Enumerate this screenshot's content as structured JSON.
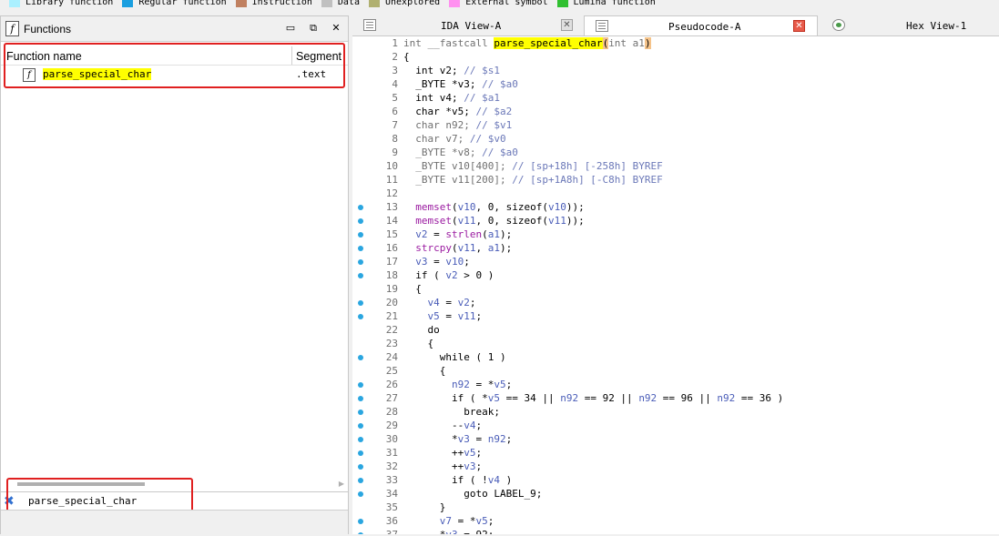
{
  "legend": [
    {
      "label": "Library function",
      "color": "#aaf0ff"
    },
    {
      "label": "Regular function",
      "color": "#1a9fe0"
    },
    {
      "label": "Instruction",
      "color": "#c08060"
    },
    {
      "label": "Data",
      "color": "#c0c0c0"
    },
    {
      "label": "Unexplored",
      "color": "#b0b070"
    },
    {
      "label": "External symbol",
      "color": "#ff90f0"
    },
    {
      "label": "Lumina function",
      "color": "#30c030"
    }
  ],
  "functions_panel": {
    "title": "Functions",
    "logo": "f",
    "columns": {
      "name": "Function name",
      "segment": "Segment"
    },
    "rows": [
      {
        "icon": "f",
        "name": "parse_special_char",
        "segment": ".text"
      }
    ],
    "filter_value": "parse_special_char",
    "btn_minimize": "▭",
    "btn_float": "⧉",
    "btn_close": "✕",
    "filter_clear": "✖",
    "scroll_right": "▶"
  },
  "tabs": [
    {
      "label": "IDA View-A",
      "close": "✕"
    },
    {
      "label": "Pseudocode-A",
      "close": "✕"
    },
    {
      "label": "Hex View-1"
    }
  ],
  "code": {
    "lines": [
      {
        "n": "1",
        "dot": false,
        "html": "<span class='c-gr'>int __fastcall </span><span class='c-hl'>parse_special_char</span><span class='c-hlp'>(</span><span class='c-gr'>int a1</span><span class='c-hlp'>)</span>"
      },
      {
        "n": "2",
        "dot": false,
        "html": "{"
      },
      {
        "n": "3",
        "dot": false,
        "html": "  int v2; <span class='c-cm'>// $s1</span>"
      },
      {
        "n": "4",
        "dot": false,
        "html": "  _BYTE *v3; <span class='c-cm'>// $a0</span>"
      },
      {
        "n": "5",
        "dot": false,
        "html": "  int v4; <span class='c-cm'>// $a1</span>"
      },
      {
        "n": "6",
        "dot": false,
        "html": "  char *v5; <span class='c-cm'>// $a2</span>"
      },
      {
        "n": "7",
        "dot": false,
        "html": "  <span class='c-gr'>char n92;</span> <span class='c-cm'>// $v1</span>"
      },
      {
        "n": "8",
        "dot": false,
        "html": "  <span class='c-gr'>char v7;</span> <span class='c-cm'>// $v0</span>"
      },
      {
        "n": "9",
        "dot": false,
        "html": "  <span class='c-gr'>_BYTE *v8;</span> <span class='c-cm'>// $a0</span>"
      },
      {
        "n": "10",
        "dot": false,
        "html": "  <span class='c-gr'>_BYTE v10[400];</span> <span class='c-cm'>// [sp+18h] [-258h] BYREF</span>"
      },
      {
        "n": "11",
        "dot": false,
        "html": "  <span class='c-gr'>_BYTE v11[200];</span> <span class='c-cm'>// [sp+1A8h] [-C8h] BYREF</span>"
      },
      {
        "n": "12",
        "dot": false,
        "html": ""
      },
      {
        "n": "13",
        "dot": true,
        "html": "  <span class='c-fn'>memset</span>(<span class='c-var'>v10</span>, 0, sizeof(<span class='c-var'>v10</span>));"
      },
      {
        "n": "14",
        "dot": true,
        "html": "  <span class='c-fn'>memset</span>(<span class='c-var'>v11</span>, 0, sizeof(<span class='c-var'>v11</span>));"
      },
      {
        "n": "15",
        "dot": true,
        "html": "  <span class='c-var'>v2</span> = <span class='c-fn'>strlen</span>(<span class='c-var'>a1</span>);"
      },
      {
        "n": "16",
        "dot": true,
        "html": "  <span class='c-fn'>strcpy</span>(<span class='c-var'>v11</span>, <span class='c-var'>a1</span>);"
      },
      {
        "n": "17",
        "dot": true,
        "html": "  <span class='c-var'>v3</span> = <span class='c-var'>v10</span>;"
      },
      {
        "n": "18",
        "dot": true,
        "html": "  if ( <span class='c-var'>v2</span> &gt; 0 )"
      },
      {
        "n": "19",
        "dot": false,
        "html": "  {"
      },
      {
        "n": "20",
        "dot": true,
        "html": "    <span class='c-var'>v4</span> = <span class='c-var'>v2</span>;"
      },
      {
        "n": "21",
        "dot": true,
        "html": "    <span class='c-var'>v5</span> = <span class='c-var'>v11</span>;"
      },
      {
        "n": "22",
        "dot": false,
        "html": "    do"
      },
      {
        "n": "23",
        "dot": false,
        "html": "    {"
      },
      {
        "n": "24",
        "dot": true,
        "html": "      while ( 1 )"
      },
      {
        "n": "25",
        "dot": false,
        "html": "      {"
      },
      {
        "n": "26",
        "dot": true,
        "html": "        <span class='c-var'>n92</span> = *<span class='c-var'>v5</span>;"
      },
      {
        "n": "27",
        "dot": true,
        "html": "        if ( *<span class='c-var'>v5</span> == 34 || <span class='c-var'>n92</span> == 92 || <span class='c-var'>n92</span> == 96 || <span class='c-var'>n92</span> == 36 )"
      },
      {
        "n": "28",
        "dot": true,
        "html": "          break;"
      },
      {
        "n": "29",
        "dot": true,
        "html": "        --<span class='c-var'>v4</span>;"
      },
      {
        "n": "30",
        "dot": true,
        "html": "        *<span class='c-var'>v3</span> = <span class='c-var'>n92</span>;"
      },
      {
        "n": "31",
        "dot": true,
        "html": "        ++<span class='c-var'>v5</span>;"
      },
      {
        "n": "32",
        "dot": true,
        "html": "        ++<span class='c-var'>v3</span>;"
      },
      {
        "n": "33",
        "dot": true,
        "html": "        if ( !<span class='c-var'>v4</span> )"
      },
      {
        "n": "34",
        "dot": true,
        "html": "          goto LABEL_9;"
      },
      {
        "n": "35",
        "dot": false,
        "html": "      }"
      },
      {
        "n": "36",
        "dot": true,
        "html": "      <span class='c-var'>v7</span> = *<span class='c-var'>v5</span>;"
      },
      {
        "n": "37",
        "dot": true,
        "html": "      *<span class='c-var'>v3</span> = 92;"
      }
    ]
  }
}
